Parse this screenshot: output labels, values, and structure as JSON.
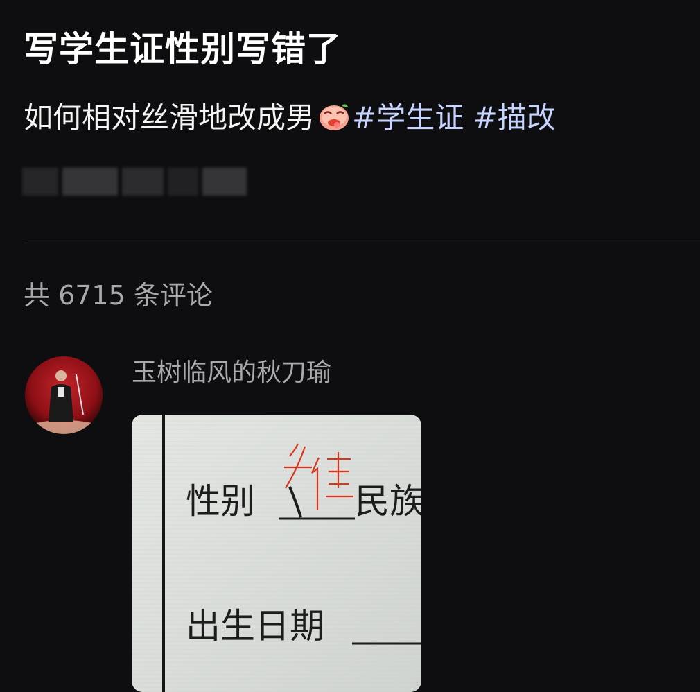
{
  "post": {
    "title": "写学生证性别写错了",
    "body_text": "如何相对丝滑地改成男",
    "emoji": "face-with-tongue-icon",
    "hashtags": [
      "#学生证",
      "#描改"
    ]
  },
  "comments": {
    "count_text": "共 6715 条评论",
    "items": [
      {
        "author": "玉树临风的秋刀瑜",
        "photo": {
          "field_gender": "性别",
          "field_ethnicity": "民族",
          "field_birthdate": "出生日期",
          "ink_color": "#d8351e"
        }
      }
    ]
  },
  "colors": {
    "background": "#0e0e10",
    "hashtag": "#c6d4ff",
    "muted_text": "#a8a8ad",
    "divider": "#2f2f33"
  }
}
